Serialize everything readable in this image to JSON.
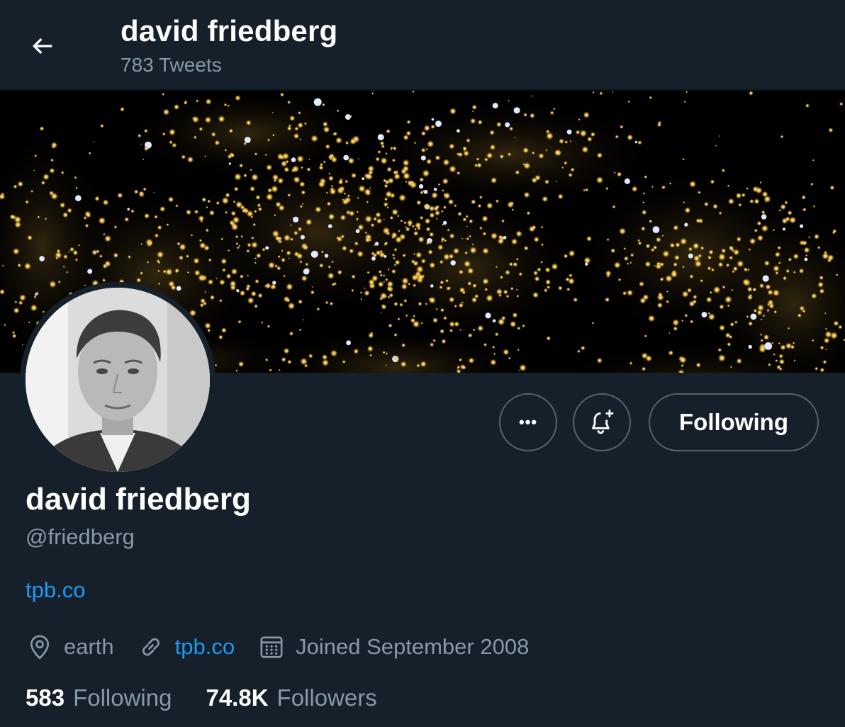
{
  "header": {
    "title": "david friedberg",
    "tweet_count": "783 Tweets"
  },
  "profile": {
    "name": "david friedberg",
    "handle": "@friedberg",
    "bio_link": "tpb.co",
    "location": "earth",
    "website": "tpb.co",
    "joined": "Joined September 2008"
  },
  "actions": {
    "more_label": "•••",
    "follow_label": "Following"
  },
  "stats": {
    "following_count": "583",
    "following_label": "Following",
    "followers_count": "74.8K",
    "followers_label": "Followers"
  },
  "icons": {
    "back": "arrow-left-icon",
    "more": "more-icon",
    "notify": "bell-plus-icon",
    "location": "location-pin-icon",
    "link": "link-icon",
    "calendar": "calendar-icon"
  },
  "colors": {
    "background": "#15202b",
    "secondary_text": "#8899a6",
    "link": "#1d9bf0",
    "border": "#536471",
    "banner_gold": "#f5c542"
  }
}
